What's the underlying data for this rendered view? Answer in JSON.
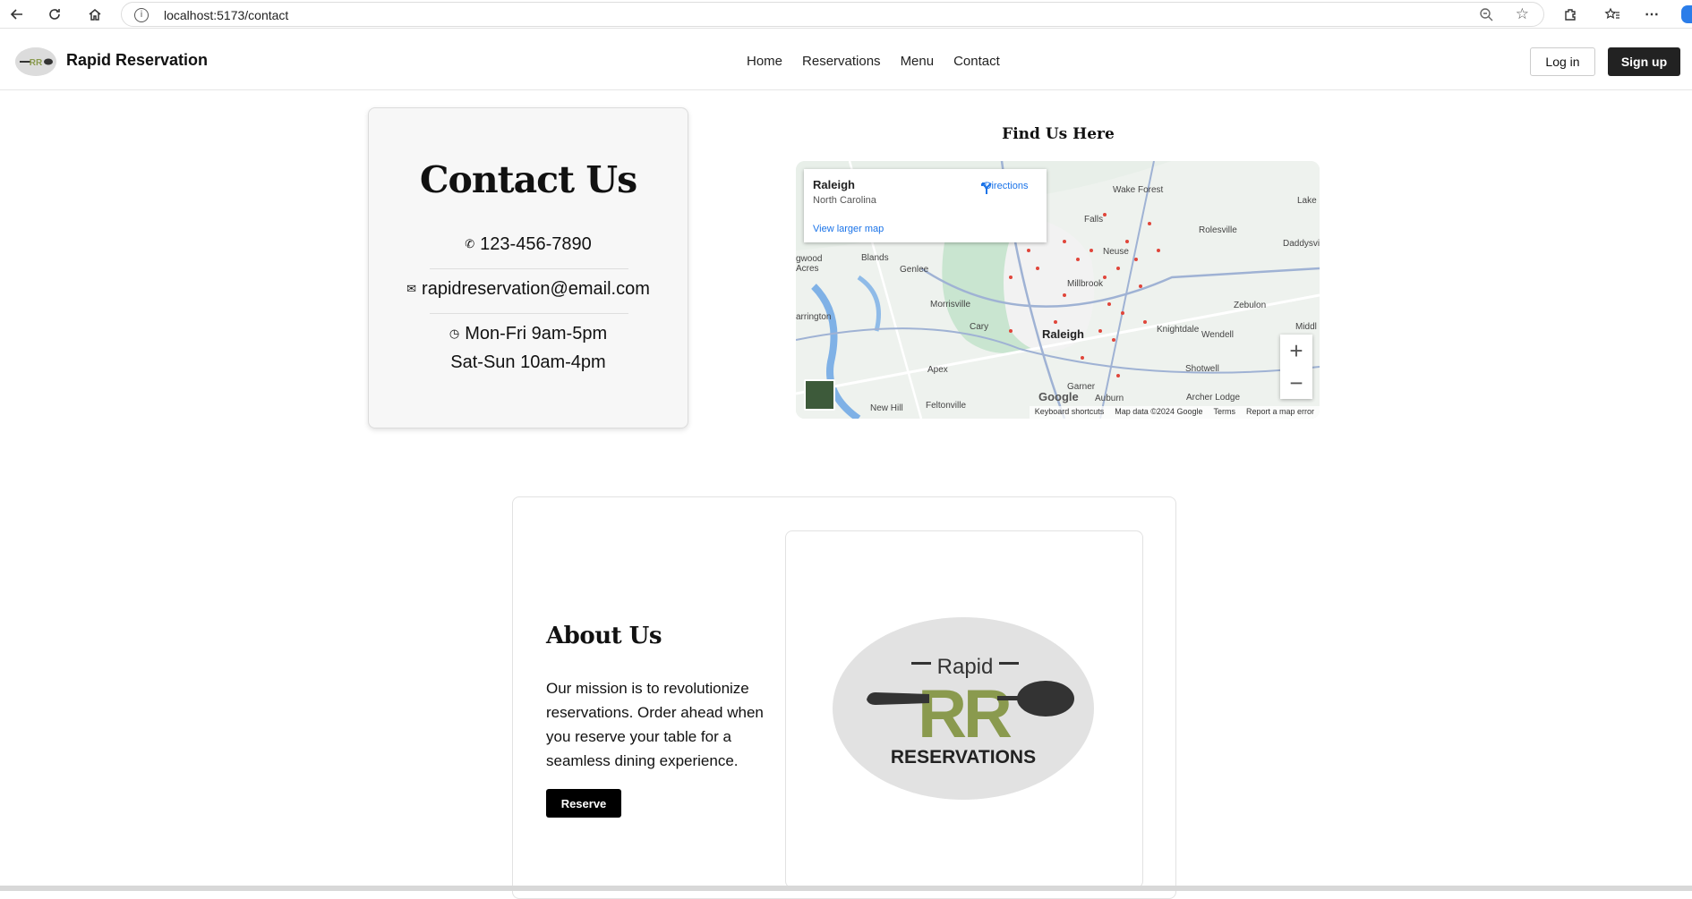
{
  "browser": {
    "url": "localhost:5173/contact",
    "info_icon": "i"
  },
  "nav": {
    "brand": "Rapid Reservation",
    "links": [
      "Home",
      "Reservations",
      "Menu",
      "Contact"
    ],
    "login": "Log in",
    "signup": "Sign up"
  },
  "contact": {
    "title": "Contact Us",
    "phone": "123-456-7890",
    "email": "rapidreservation@email.com",
    "hours_weekday": "Mon-Fri 9am-5pm",
    "hours_weekend": "Sat-Sun 10am-4pm"
  },
  "map": {
    "title": "Find Us Here",
    "place": "Raleigh",
    "region": "North Carolina",
    "directions": "Directions",
    "view_larger": "View larger map",
    "labels": [
      "Raleigh",
      "Wake Forest",
      "Rolesville",
      "Falls",
      "Neuse",
      "Millbrook",
      "Knightdale",
      "Wendell",
      "Zebulon",
      "Morrisville",
      "Cary",
      "Apex",
      "Garner",
      "Auburn",
      "Shotwell",
      "Archer Lodge",
      "Blands",
      "Genlee",
      "Daddysville",
      "Lake R",
      "Middle",
      "New Hill",
      "Feltonville",
      "gwood Acres",
      "arrington"
    ],
    "attribution": [
      "Keyboard shortcuts",
      "Map data ©2024 Google",
      "Terms",
      "Report a map error"
    ],
    "google": "Google",
    "zoom_in": "+",
    "zoom_out": "−"
  },
  "about": {
    "title": "About Us",
    "text": "Our mission is to revolutionize reservations. Order ahead when you reserve your table for a seamless dining experience.",
    "button": "Reserve",
    "logo_top": "Rapid",
    "logo_mid": "RR",
    "logo_bottom": "RESERVATIONS"
  },
  "colors": {
    "accent_olive": "#8a9a4e",
    "dark": "#222222",
    "link_blue": "#1a73e8"
  }
}
